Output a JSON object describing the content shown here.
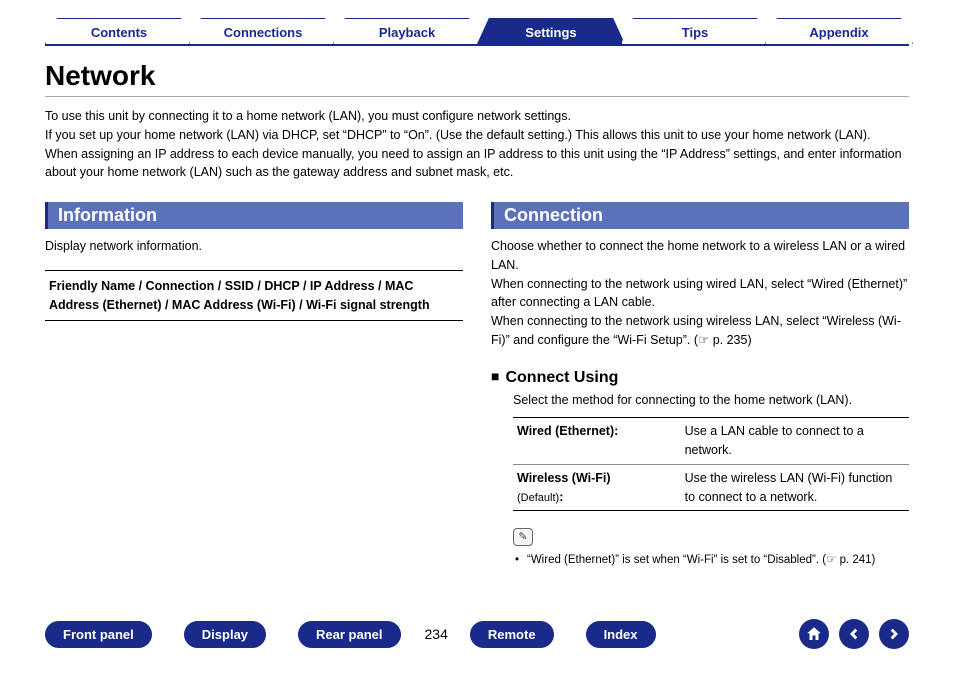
{
  "tabs": {
    "contents": "Contents",
    "connections": "Connections",
    "playback": "Playback",
    "settings": "Settings",
    "tips": "Tips",
    "appendix": "Appendix",
    "active": "settings"
  },
  "page_title": "Network",
  "intro_1": "To use this unit by connecting it to a home network (LAN), you must configure network settings.",
  "intro_2": "If you set up your home network (LAN) via DHCP, set “DHCP” to “On”. (Use the default setting.) This allows this unit to use your home network (LAN).",
  "intro_3": "When assigning an IP address to each device manually, you need to assign an IP address to this unit using the “IP Address” settings, and enter information about your home network (LAN) such as the gateway address and subnet mask, etc.",
  "left": {
    "heading": "Information",
    "desc": "Display network information.",
    "box": "Friendly Name / Connection / SSID / DHCP / IP Address / MAC Address (Ethernet) / MAC Address (Wi-Fi) / Wi-Fi signal strength"
  },
  "right": {
    "heading": "Connection",
    "p1": "Choose whether to connect the home network to a wireless LAN or a wired LAN.",
    "p2": "When connecting to the network using wired LAN, select “Wired (Ethernet)” after connecting a LAN cable.",
    "p3": "When connecting to the network using wireless LAN, select “Wireless (Wi-Fi)” and configure the “Wi-Fi Setup”. (",
    "p3_ref": "p. 235)",
    "sub_heading": "Connect Using",
    "sub_desc": "Select the method for connecting to the home network (LAN).",
    "opt1_label": "Wired (Ethernet):",
    "opt1_desc": "Use a LAN cable to connect to a network.",
    "opt2_label_a": "Wireless (Wi-Fi)",
    "opt2_label_b": "(Default)",
    "opt2_label_c": ":",
    "opt2_desc": "Use the wireless LAN (Wi-Fi) function to connect to a network.",
    "note": "“Wired (Ethernet)” is set when “Wi-Fi” is set to “Disabled”.  (",
    "note_ref": "p. 241)"
  },
  "footer": {
    "front_panel": "Front panel",
    "display": "Display",
    "rear_panel": "Rear panel",
    "page": "234",
    "remote": "Remote",
    "index": "Index"
  }
}
